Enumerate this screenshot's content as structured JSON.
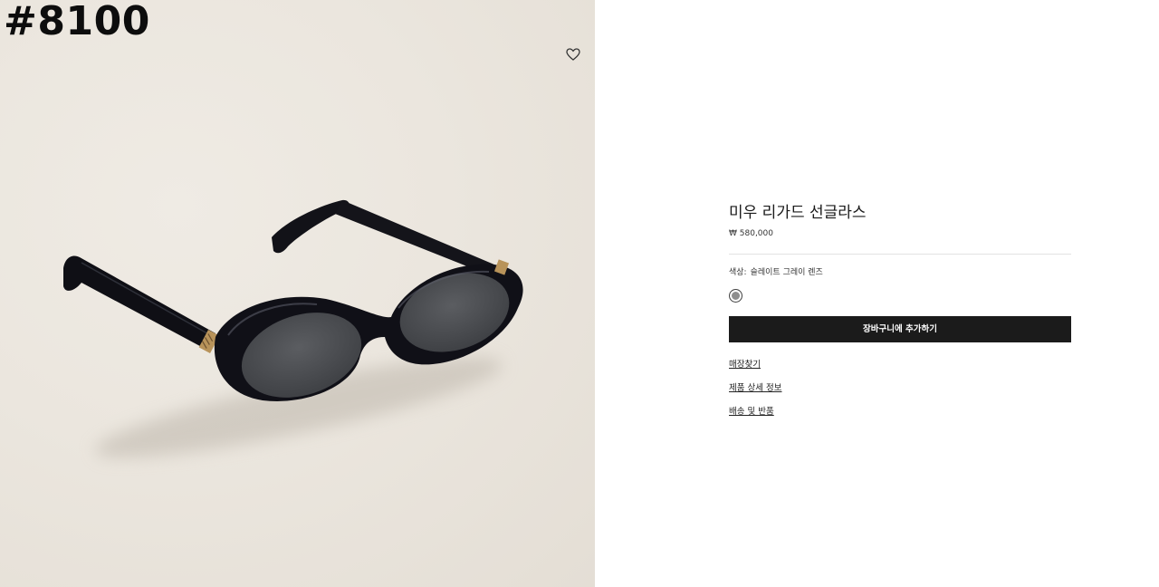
{
  "gallery": {
    "page_number": "#8100",
    "wishlist_icon": "heart-outline-icon",
    "product_image": "black-oval-sunglasses-photo"
  },
  "product": {
    "title": "미우 리가드 선글라스",
    "price": "₩ 580,000",
    "color_label": "색상:",
    "color_value": "슬레이트 그레이 렌즈",
    "swatch_color": "#8e8e8e",
    "add_to_cart": "장바구니에 추가하기"
  },
  "links": {
    "find_store": "매장찾기",
    "product_details": "제품 상세 정보",
    "shipping_returns": "배송 및 반품"
  },
  "colors": {
    "button_bg": "#1b1b1b",
    "background_image": "#ebe6de"
  }
}
